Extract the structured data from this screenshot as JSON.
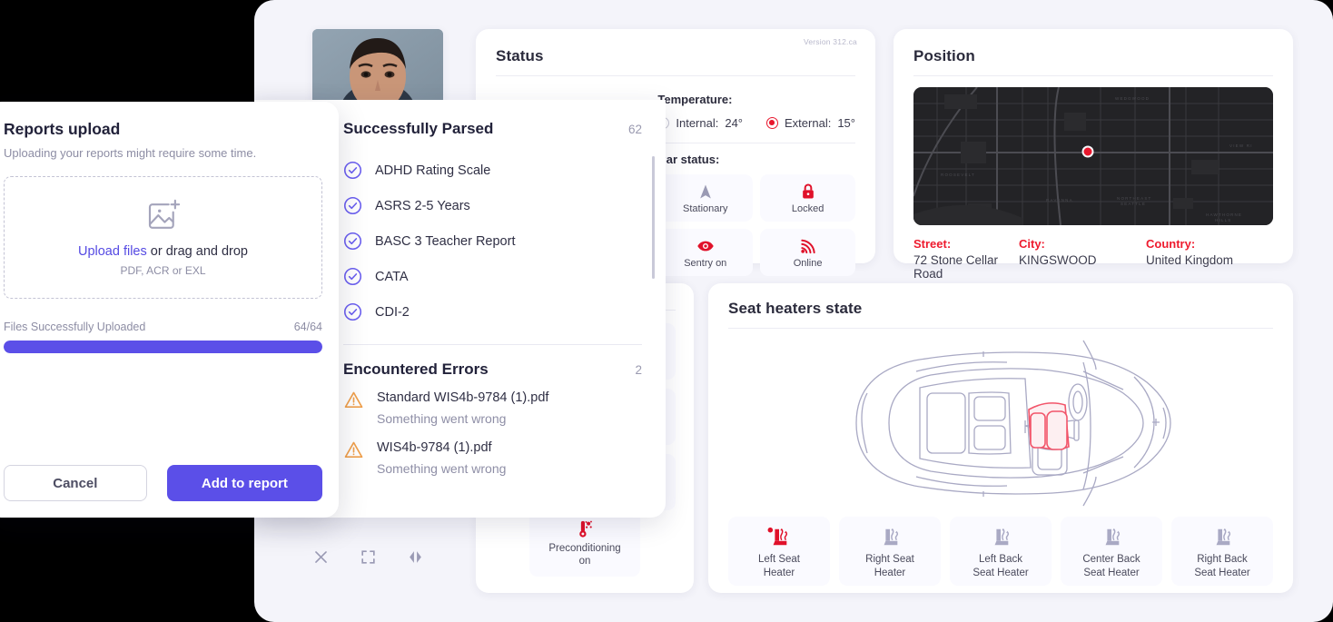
{
  "dashboard": {
    "status_card": {
      "title": "Status",
      "version": "Version 312.ca",
      "temperature_label": "Temperature:",
      "temp_options": [
        {
          "label": "Internal:",
          "value": "24°",
          "selected": false
        },
        {
          "label": "External:",
          "value": "15°",
          "selected": true
        }
      ],
      "car_status_label": "Car status:",
      "tiles": [
        {
          "icon": "navigation-arrow-icon",
          "label": "Stationary"
        },
        {
          "icon": "lock-closed-icon",
          "label": "Locked"
        },
        {
          "icon": "eye-icon",
          "label": "Sentry on"
        },
        {
          "icon": "signal-wifi-icon",
          "label": "Online"
        }
      ]
    },
    "position_card": {
      "title": "Position",
      "fields": [
        {
          "key": "Street:",
          "value": "72  Stone Cellar Road"
        },
        {
          "key": "City:",
          "value": "KINGSWOOD"
        },
        {
          "key": "Country:",
          "value": "United Kingdom"
        }
      ]
    },
    "seat_card": {
      "title": "Seat heaters state",
      "heaters": [
        {
          "label": "Left Seat\nHeater",
          "line1": "Left Seat",
          "line2": "Heater",
          "active": true
        },
        {
          "label": "Right Seat Heater",
          "line1": "Right Seat",
          "line2": "Heater",
          "active": false
        },
        {
          "label": "Left Back Seat Heater",
          "line1": "Left Back",
          "line2": "Seat Heater",
          "active": false
        },
        {
          "label": "Center Back Seat Heater",
          "line1": "Center Back",
          "line2": "Seat Heater",
          "active": false
        },
        {
          "label": "Right Back Seat Heater",
          "line1": "Right Back",
          "line2": "Seat Heater",
          "active": false
        }
      ]
    },
    "left_card": {
      "preconditioning": {
        "line1": "Preconditioning",
        "line2": "on"
      }
    },
    "toolbar": [
      {
        "icon": "close-icon",
        "name": "close-button"
      },
      {
        "icon": "fullscreen-icon",
        "name": "fullscreen-button"
      },
      {
        "icon": "split-view-icon",
        "name": "split-view-button"
      }
    ]
  },
  "parsed_panel": {
    "success": {
      "title": "Successfully Parsed",
      "count": "62",
      "items": [
        "ADHD Rating Scale",
        "ASRS 2-5 Years",
        "BASC 3 Teacher Report",
        "CATA",
        "CDI-2"
      ]
    },
    "errors": {
      "title": "Encountered Errors",
      "count": "2",
      "items": [
        {
          "name": "Standard WIS4b-9784 (1).pdf",
          "message": "Something went wrong"
        },
        {
          "name": "WIS4b-9784 (1).pdf",
          "message": "Something went wrong"
        }
      ]
    }
  },
  "upload_dialog": {
    "title": "Reports upload",
    "subtitle": "Uploading your reports might require some time.",
    "dropzone": {
      "icon": "image-plus-icon",
      "link_text": "Upload files",
      "caption_rest": " or drag and drop",
      "hint": "PDF, ACR or EXL"
    },
    "progress": {
      "label": "Files Successfully Uploaded",
      "count": "64/64",
      "percent": 100
    },
    "cancel_label": "Cancel",
    "submit_label": "Add to report"
  },
  "colors": {
    "accent": "#5b4fe8",
    "danger": "#e8182e",
    "warning": "#f0a04b",
    "success": "#18ce34",
    "page_bg": "#f4f4fa"
  }
}
